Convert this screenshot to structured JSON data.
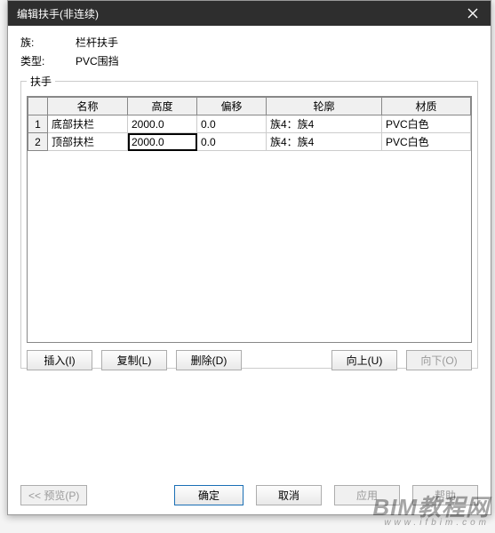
{
  "title": "编辑扶手(非连续)",
  "info": {
    "family_label": "族:",
    "family_value": "栏杆扶手",
    "type_label": "类型:",
    "type_value": "PVC围挡"
  },
  "fieldset_legend": "扶手",
  "columns": {
    "name": "名称",
    "height": "高度",
    "offset": "偏移",
    "profile": "轮廓",
    "material": "材质"
  },
  "rows": [
    {
      "idx": "1",
      "name": "底部扶栏",
      "height": "2000.0",
      "offset": "0.0",
      "profile": "族4：族4",
      "material": "PVC白色"
    },
    {
      "idx": "2",
      "name": "顶部扶栏",
      "height": "2000.0",
      "offset": "0.0",
      "profile": "族4：族4",
      "material": "PVC白色"
    }
  ],
  "selected": {
    "row": 1,
    "col": "height"
  },
  "buttons": {
    "insert": "插入(I)",
    "duplicate": "复制(L)",
    "delete": "删除(D)",
    "up": "向上(U)",
    "down": "向下(O)",
    "preview": "<< 预览(P)",
    "ok": "确定",
    "cancel": "取消",
    "apply": "应用",
    "help": "帮助"
  },
  "watermark": {
    "main": "BIM教程网",
    "sub": "www.ifbim.com"
  }
}
